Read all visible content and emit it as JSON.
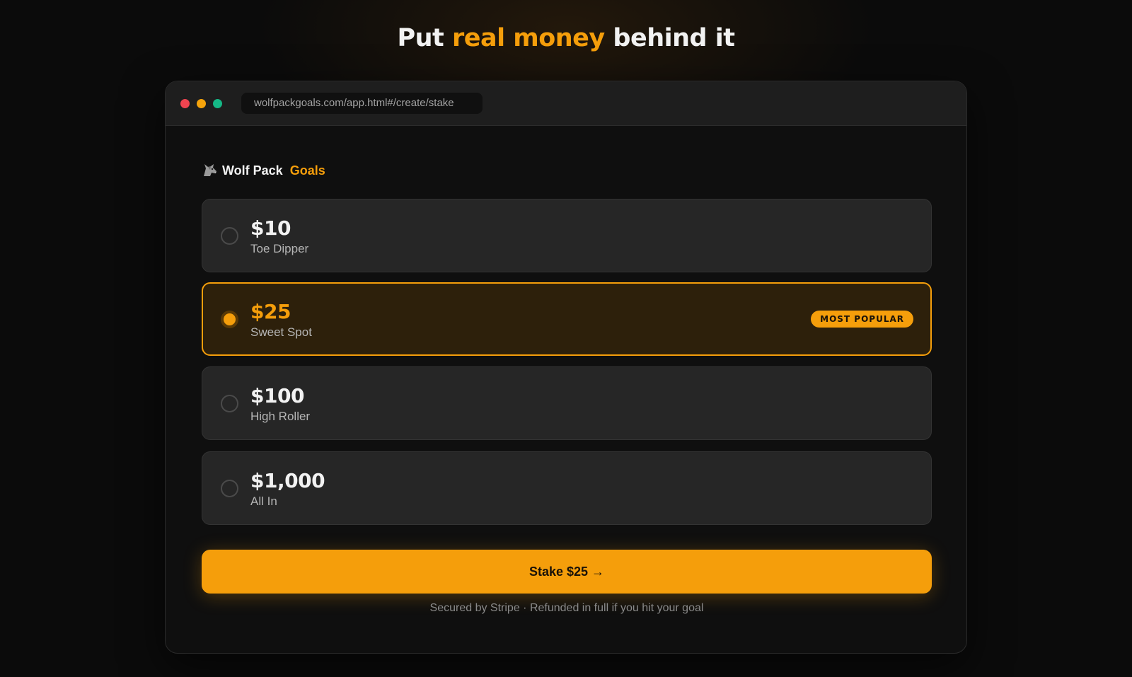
{
  "headline": {
    "prefix": "Put ",
    "accent": "real money",
    "suffix": " behind it"
  },
  "browser": {
    "url": "wolfpackgoals.com/app.html#/create/stake"
  },
  "brand": {
    "icon": "wolf-icon",
    "name": "Wolf Pack",
    "accent": "Goals"
  },
  "options": [
    {
      "amount": "$10",
      "label": "Toe Dipper",
      "selected": false
    },
    {
      "amount": "$25",
      "label": "Sweet Spot",
      "selected": true,
      "badge": "MOST POPULAR"
    },
    {
      "amount": "$100",
      "label": "High Roller",
      "selected": false
    },
    {
      "amount": "$1,000",
      "label": "All In",
      "selected": false
    }
  ],
  "cta": {
    "label": "Stake $25 →"
  },
  "footnote": "Secured by Stripe · Refunded in full if you hit your goal",
  "colors": {
    "accent": "#f59e0b",
    "background": "#0b0b0b",
    "card": "#262626",
    "selected_card": "#2d200b"
  }
}
